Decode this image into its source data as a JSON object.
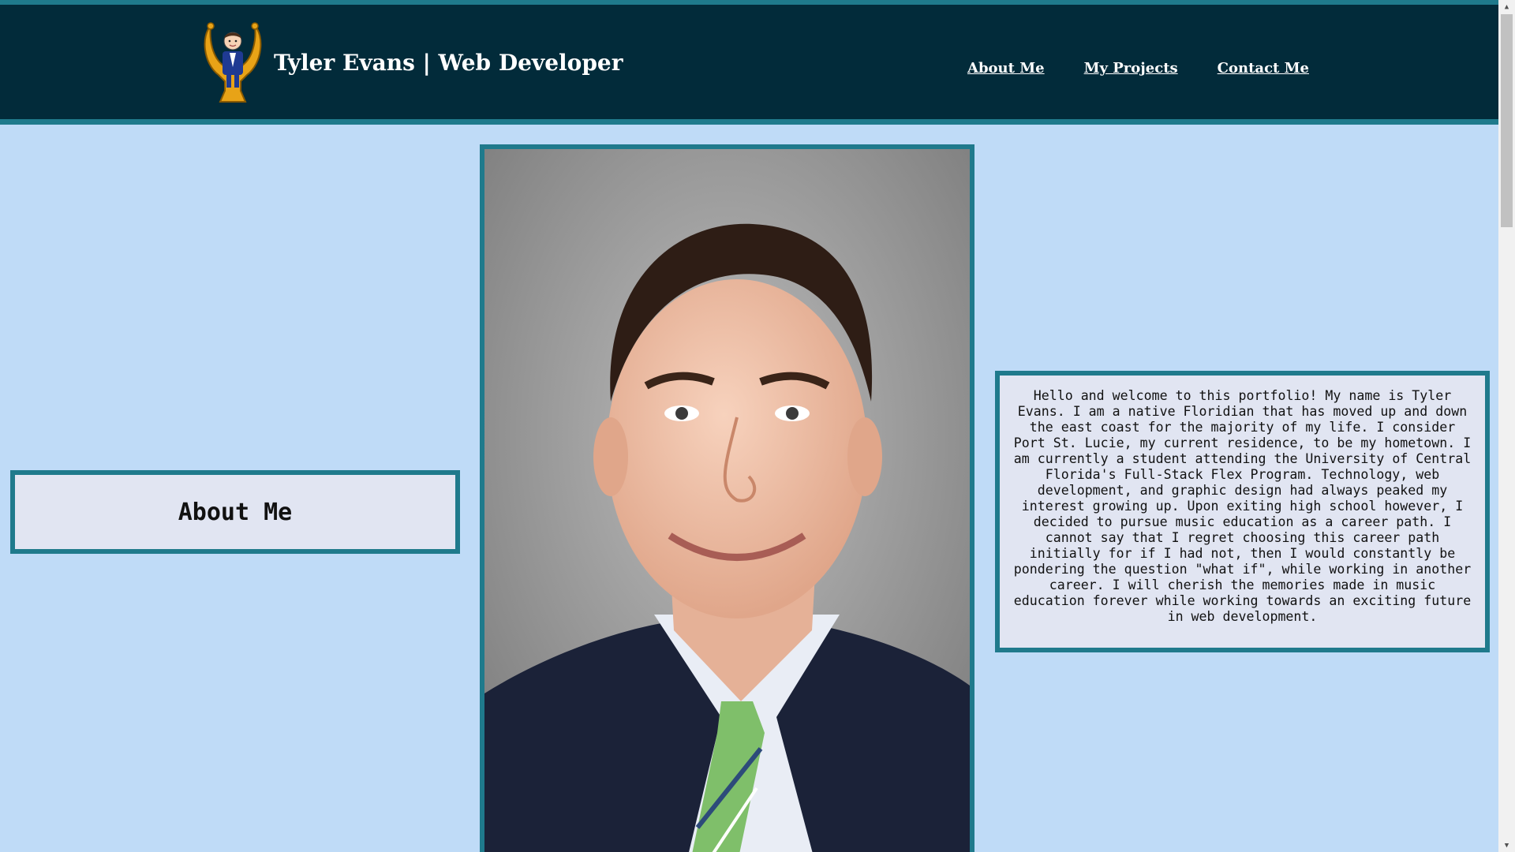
{
  "header": {
    "title": "Tyler Evans | Web Developer",
    "logo_icon": "lyre-mascot-icon",
    "nav": [
      {
        "label": "About Me"
      },
      {
        "label": "My Projects"
      },
      {
        "label": "Contact Me"
      }
    ]
  },
  "main": {
    "section_heading": "About Me",
    "bio": "Hello and welcome to this portfolio! My name is Tyler Evans. I am a native Floridian that has moved up and down the east coast for the majority of my life. I consider Port St. Lucie, my current residence, to be my hometown. I am currently a student attending the University of Central Florida's Full-Stack Flex Program. Technology, web development, and graphic design had always peaked my interest growing up. Upon exiting high school however, I decided to pursue music education as a career path. I cannot say that I regret choosing this career path initially for if I had not, then I would constantly be pondering the question \"what if\", while working in another career. I will cherish the memories made in music education forever while working towards an exciting future in web development."
  },
  "colors": {
    "background": "#bfdbf7",
    "header": "#022b3a",
    "accent": "#1f7a8c",
    "panel": "#e1e5f2",
    "text_light": "#ffffff"
  }
}
